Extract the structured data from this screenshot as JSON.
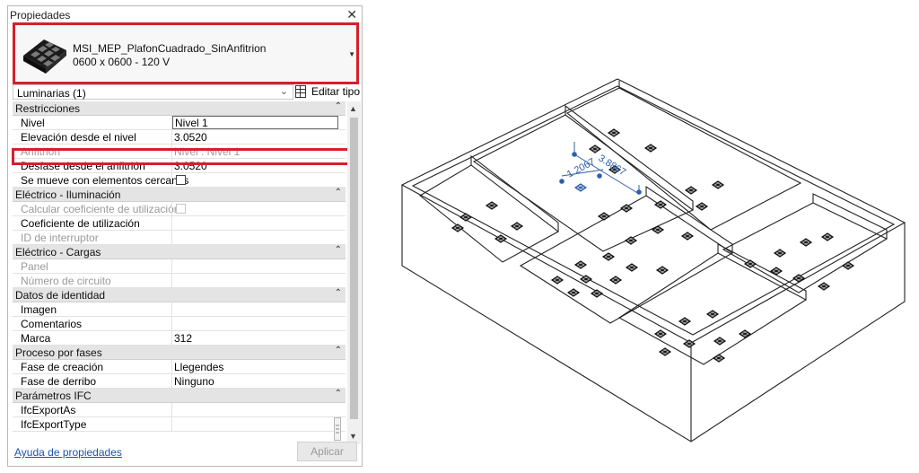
{
  "panel": {
    "title": "Propiedades",
    "close_glyph": "✕"
  },
  "type_selector": {
    "name": "MSI_MEP_PlafonCuadrado_SinAnfitrion",
    "size": "0600 x 0600 - 120 V",
    "dropdown_glyph": "▼",
    "highlight_color": "#d5202b"
  },
  "category": {
    "label": "Luminarias (1)",
    "chevron": "⌄"
  },
  "edit_type": {
    "label": "Editar tipo",
    "icon": "edit-type-icon"
  },
  "properties": {
    "restricciones": {
      "title": "Restricciones"
    },
    "nivel": {
      "label": "Nivel",
      "value": "Nivel 1"
    },
    "elevacion": {
      "label": "Elevación desde el nivel",
      "value": "3.0520"
    },
    "anfitrion": {
      "label": "Anfitrión",
      "value": "Nivel : Nivel 1"
    },
    "desfase": {
      "label": "Desfase desde el anfitrión",
      "value": "3.0520"
    },
    "se_mueve": {
      "label": "Se mueve con elementos cercanos"
    },
    "iluminacion": {
      "title": "Eléctrico - Iluminación"
    },
    "calcular": {
      "label": "Calcular coeficiente de utilización"
    },
    "coeficiente": {
      "label": "Coeficiente de utilización"
    },
    "id_interruptor": {
      "label": "ID de interruptor"
    },
    "cargas": {
      "title": "Eléctrico - Cargas"
    },
    "panel": {
      "label": "Panel"
    },
    "numero_circuito": {
      "label": "Número de circuito"
    },
    "identidad": {
      "title": "Datos de identidad"
    },
    "imagen": {
      "label": "Imagen"
    },
    "comentarios": {
      "label": "Comentarios"
    },
    "marca": {
      "label": "Marca",
      "value": "312"
    },
    "fases": {
      "title": "Proceso por fases"
    },
    "fase_creacion": {
      "label": "Fase de creación",
      "value": "Llegendes"
    },
    "fase_derribo": {
      "label": "Fase de derribo",
      "value": "Ninguno"
    },
    "ifc": {
      "title": "Parámetros IFC"
    },
    "ifc_export_as": {
      "label": "IfcExportAs"
    },
    "ifc_export_type": {
      "label": "IfcExportType"
    },
    "collapse_glyph": "⌃"
  },
  "scrollbar": {
    "up": "▲",
    "down": "▼"
  },
  "footer": {
    "help_link": "Ayuda de propiedades",
    "apply_label": "Aplicar"
  },
  "model_view": {
    "dim_labels": [
      "1.2067",
      "3.8867"
    ],
    "dim_color": "#2d5fa8",
    "line_color": "#222222"
  }
}
